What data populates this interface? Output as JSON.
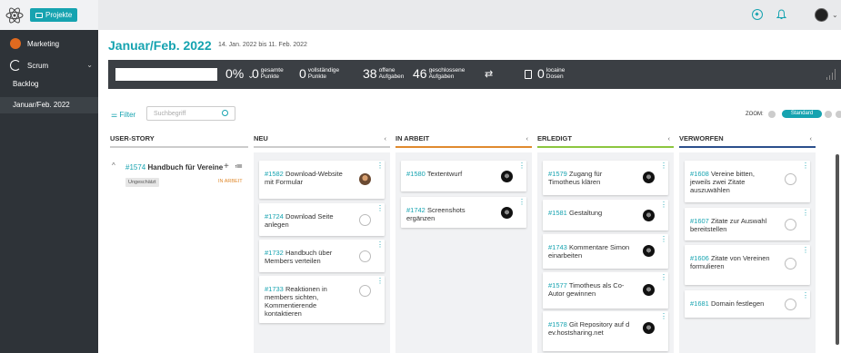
{
  "sidebar": {
    "projects_label": "Projekte",
    "marketing": "Marketing",
    "scrum": "Scrum",
    "backlog": "Backlog",
    "sprint": "Januar/Feb. 2022"
  },
  "header": {
    "title": "Januar/Feb. 2022",
    "dates": "14. Jan. 2022 bis 11. Feb. 2022"
  },
  "stats": {
    "percent": "0%",
    "total_num": "0",
    "total_label1": "gesamte",
    "total_label2": "Punkte",
    "complete_num": "0",
    "complete_label1": "vollständige",
    "complete_label2": "Punkte",
    "open_num": "38",
    "open_label1": "offene",
    "open_label2": "Aufgaben",
    "closed_num": "46",
    "closed_label1": "geschlossene",
    "closed_label2": "Aufgaben",
    "local_num": "0",
    "local_label1": "locaine",
    "local_label2": "Dosen",
    "progress": 0
  },
  "toolbar": {
    "filter": "Filter",
    "search_placeholder": "Suchbegriff",
    "zoom_label": "ZOOM:",
    "zoom_standard": "Standard"
  },
  "columns": {
    "story": "USER-STORY",
    "neu": "NEU",
    "inarbeit": "IN ARBEIT",
    "erledigt": "ERLEDIGT",
    "verworfen": "VERWORFEN"
  },
  "colors": {
    "accent": "#16a3b0",
    "neu": "#cccccc",
    "inarbeit": "#e08a2e",
    "erledigt": "#8cc63f",
    "verworfen": "#2b4f8c"
  },
  "story": {
    "id": "#1574",
    "title": "Handbuch für Vereine",
    "estimate": "Ungeschätzt",
    "status": "IN ARBEIT"
  },
  "cards": {
    "neu": [
      {
        "id": "#1582",
        "text": "Download-Website mit Formular"
      },
      {
        "id": "#1724",
        "text": "Download Seite anlegen"
      },
      {
        "id": "#1732",
        "text": "Handbuch über Members verteilen"
      },
      {
        "id": "#1733",
        "text": "Reaktionen in members sichten, Kommentierende kontaktieren"
      }
    ],
    "inarbeit": [
      {
        "id": "#1580",
        "text": "Textentwurf"
      },
      {
        "id": "#1742",
        "text": "Screenshots ergänzen"
      }
    ],
    "erledigt": [
      {
        "id": "#1579",
        "text": "Zugang für Timotheus klären"
      },
      {
        "id": "#1581",
        "text": "Gestaltung"
      },
      {
        "id": "#1743",
        "text": "Kommentare Simon einarbeiten"
      },
      {
        "id": "#1577",
        "text": "Timotheus als Co-Autor gewinnen"
      },
      {
        "id": "#1578",
        "text": "Git Repository auf dev.hostsharing.net"
      }
    ],
    "verworfen": [
      {
        "id": "#1608",
        "text": "Vereine bitten, jeweils zwei Zitate auszuwählen"
      },
      {
        "id": "#1607",
        "text": "Zitate zur Auswahl bereitstellen"
      },
      {
        "id": "#1606",
        "text": "Zitate von Vereinen formulieren"
      },
      {
        "id": "#1681",
        "text": "Domain festlegen"
      }
    ]
  }
}
